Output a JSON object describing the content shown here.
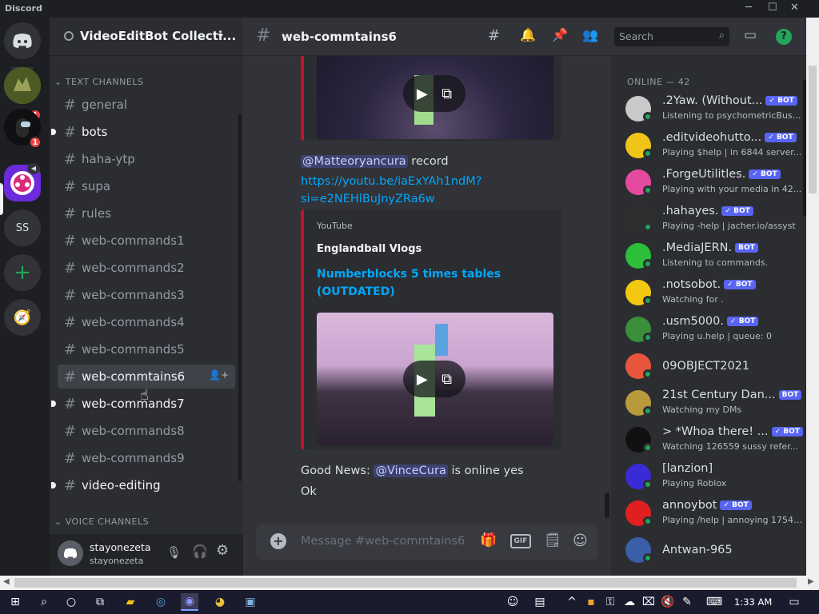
{
  "window": {
    "title": "Discord"
  },
  "guild": {
    "name": "VideoEditBot Collecti..."
  },
  "servers": [
    {
      "label": "",
      "badge": "1"
    },
    {
      "label": "",
      "badge": "1"
    },
    {
      "label": ""
    },
    {
      "label": "SS"
    }
  ],
  "categories": {
    "text": "TEXT CHANNELS",
    "voice": "VOICE CHANNELS"
  },
  "channels": [
    {
      "name": "general"
    },
    {
      "name": "bots"
    },
    {
      "name": "haha-ytp"
    },
    {
      "name": "supa"
    },
    {
      "name": "rules"
    },
    {
      "name": "web-commands1"
    },
    {
      "name": "web-commands2"
    },
    {
      "name": "web-commands3"
    },
    {
      "name": "web-commands4"
    },
    {
      "name": "web-commands5"
    },
    {
      "name": "web-commtains6"
    },
    {
      "name": "web-commands7"
    },
    {
      "name": "web-commands8"
    },
    {
      "name": "web-commands9"
    },
    {
      "name": "video-editing"
    }
  ],
  "user": {
    "display": "stayonezeta",
    "username": "stayonezeta"
  },
  "chat": {
    "channel": "web-commtains6",
    "search_placeholder": "Search",
    "composer_placeholder": "Message #web-commtains6",
    "messages": {
      "m1_mention": "@Matteoryancura",
      "m1_text": "record",
      "m1_link1": "https://youtu.be/iaExYAh1ndM?",
      "m1_link2": "si=e2NEHlBuJnyZRa6w",
      "embed_provider": "YouTube",
      "embed_author": "Englandball Vlogs",
      "embed_title1": "Numberblocks 5 times tables",
      "embed_title2": "(OUTDATED)",
      "m2_prefix": "Good News:",
      "m2_mention": "@VinceCura",
      "m2_suffix": "is online yes",
      "m3_text": "Ok"
    }
  },
  "members": {
    "header": "ONLINE — 42",
    "bot_tag": "BOT",
    "list": [
      {
        "name": ".2Yaw. (Without...",
        "status": "Listening to psychometricBus...",
        "bot": true,
        "verified": true,
        "color": "#c9c9c9"
      },
      {
        "name": ".editvideohutto...",
        "status": "Playing $help | in 6844 server...",
        "bot": true,
        "verified": true,
        "color": "#f0c419"
      },
      {
        "name": ".ForgeUtilitles.",
        "status": "Playing with your media in 42...",
        "bot": true,
        "verified": true,
        "color": "#e64aa0"
      },
      {
        "name": ".hahayes.",
        "status": "Playing -help | jacher.io/assyst",
        "bot": true,
        "verified": true,
        "color": "#2e2e2e"
      },
      {
        "name": ".MediaJERN.",
        "status": "Listening to commands.",
        "bot": true,
        "verified": false,
        "color": "#2bbf3a"
      },
      {
        "name": ".notsobot.",
        "status": "Watching for .",
        "bot": true,
        "verified": true,
        "color": "#f2c811"
      },
      {
        "name": ".usm5000.",
        "status": "Playing u.help | queue: 0",
        "bot": true,
        "verified": true,
        "color": "#3a8f3a"
      },
      {
        "name": "09OBJECT2021",
        "status": "",
        "bot": false,
        "verified": false,
        "color": "#e8553d"
      },
      {
        "name": "21st Century Dan...",
        "status": "Watching my DMs",
        "bot": true,
        "verified": false,
        "color": "#b89a3c"
      },
      {
        "name": "> *Whoa there! ...",
        "status": "Watching 126559 sussy refer...",
        "bot": true,
        "verified": true,
        "color": "#111111"
      },
      {
        "name": "[lanzion]",
        "status": "Playing Roblox",
        "bot": false,
        "verified": false,
        "color": "#3a2bd8"
      },
      {
        "name": "annoybot",
        "status": "Playing /help | annoying 1754 ...",
        "bot": true,
        "verified": true,
        "color": "#e02020"
      },
      {
        "name": "Antwan-965",
        "status": "",
        "bot": false,
        "verified": false,
        "color": "#3b5ea8"
      }
    ]
  },
  "taskbar": {
    "time": "1:33 AM"
  }
}
